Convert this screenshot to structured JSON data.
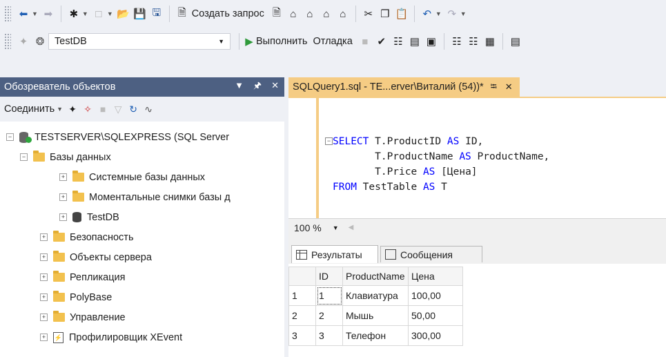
{
  "toolbar1": {
    "new_query_label": "Создать запрос"
  },
  "toolbar2": {
    "database": "TestDB",
    "execute_label": "Выполнить",
    "debug_label": "Отладка"
  },
  "object_explorer": {
    "title": "Обозреватель объектов",
    "connect_label": "Соединить",
    "tree": {
      "server": "TESTSERVER\\SQLEXPRESS (SQL Server",
      "databases": "Базы данных",
      "system_dbs": "Системные базы данных",
      "snapshots": "Моментальные снимки базы д",
      "testdb": "TestDB",
      "security": "Безопасность",
      "server_objects": "Объекты сервера",
      "replication": "Репликация",
      "polybase": "PolyBase",
      "management": "Управление",
      "xevent": "Профилировщик XEvent"
    }
  },
  "editor": {
    "tab_title": "SQLQuery1.sql - TE...erver\\Виталий (54))*",
    "code": {
      "l1_kw": "SELECT",
      "l1_rest": " T.ProductID ",
      "l1_as": "AS",
      "l1_end": " ID,",
      "l2_pre": "       T.ProductName ",
      "l2_as": "AS",
      "l2_end": " ProductName,",
      "l3_pre": "       T.Price ",
      "l3_as": "AS",
      "l3_end": " [Цена]",
      "l4_kw": "FROM",
      "l4_mid": " TestTable ",
      "l4_as": "AS",
      "l4_end": " T"
    },
    "zoom": "100 %"
  },
  "results": {
    "tab_results": "Результаты",
    "tab_messages": "Сообщения",
    "columns": [
      "ID",
      "ProductName",
      "Цена"
    ],
    "rows": [
      {
        "n": "1",
        "id": "1",
        "name": "Клавиатура",
        "price": "100,00"
      },
      {
        "n": "2",
        "id": "2",
        "name": "Мышь",
        "price": "50,00"
      },
      {
        "n": "3",
        "id": "3",
        "name": "Телефон",
        "price": "300,00"
      }
    ]
  }
}
